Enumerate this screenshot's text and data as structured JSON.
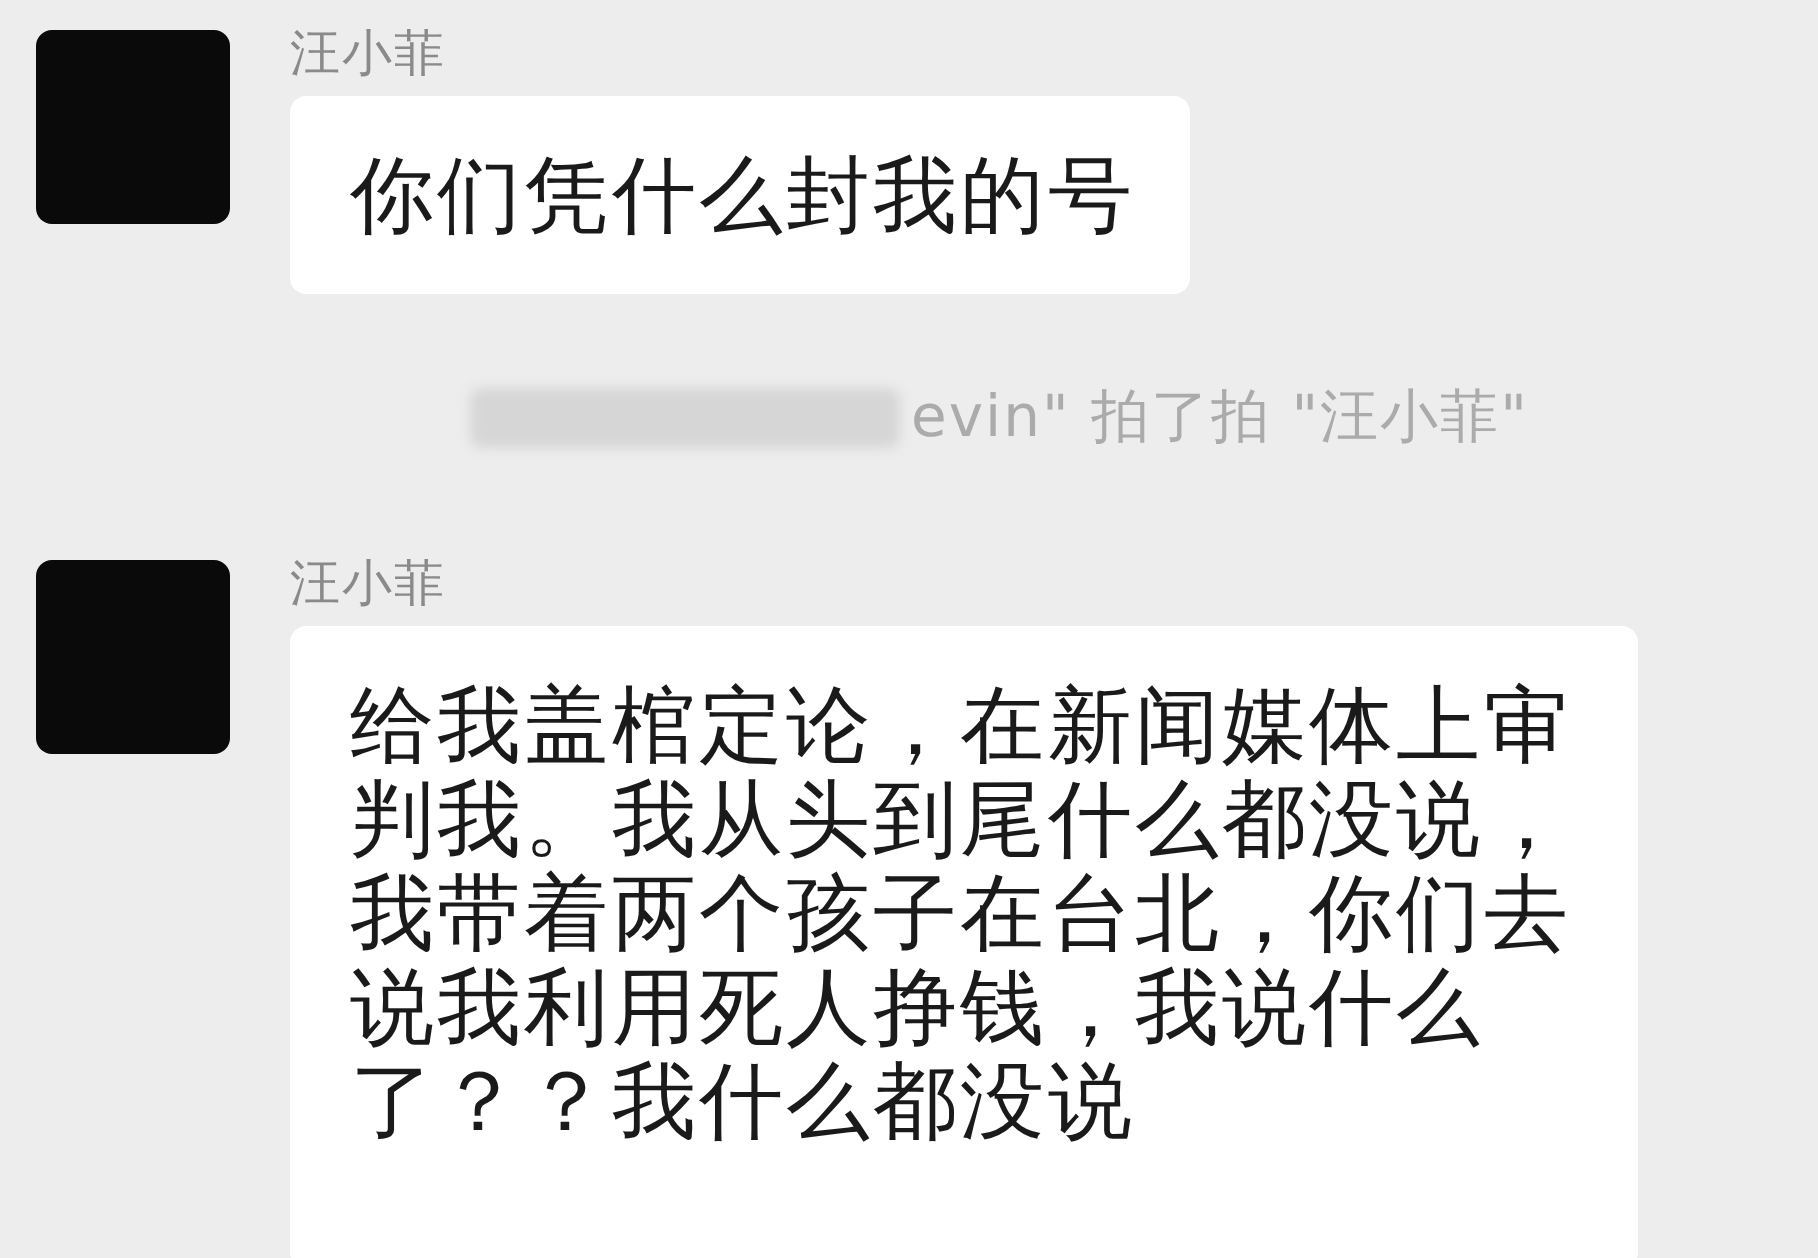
{
  "messages": [
    {
      "kind": "message",
      "sender": "汪小菲",
      "text": "你们凭什么封我的号"
    },
    {
      "kind": "system",
      "redacted": true,
      "text": "evin\" 拍了拍 \"汪小菲\""
    },
    {
      "kind": "message",
      "sender": "汪小菲",
      "text": "给我盖棺定论，在新闻媒体上审判我。我从头到尾什么都没说，我带着两个孩子在台北，你们去说我利用死人挣钱，我说什么了？？我什么都没说"
    }
  ]
}
